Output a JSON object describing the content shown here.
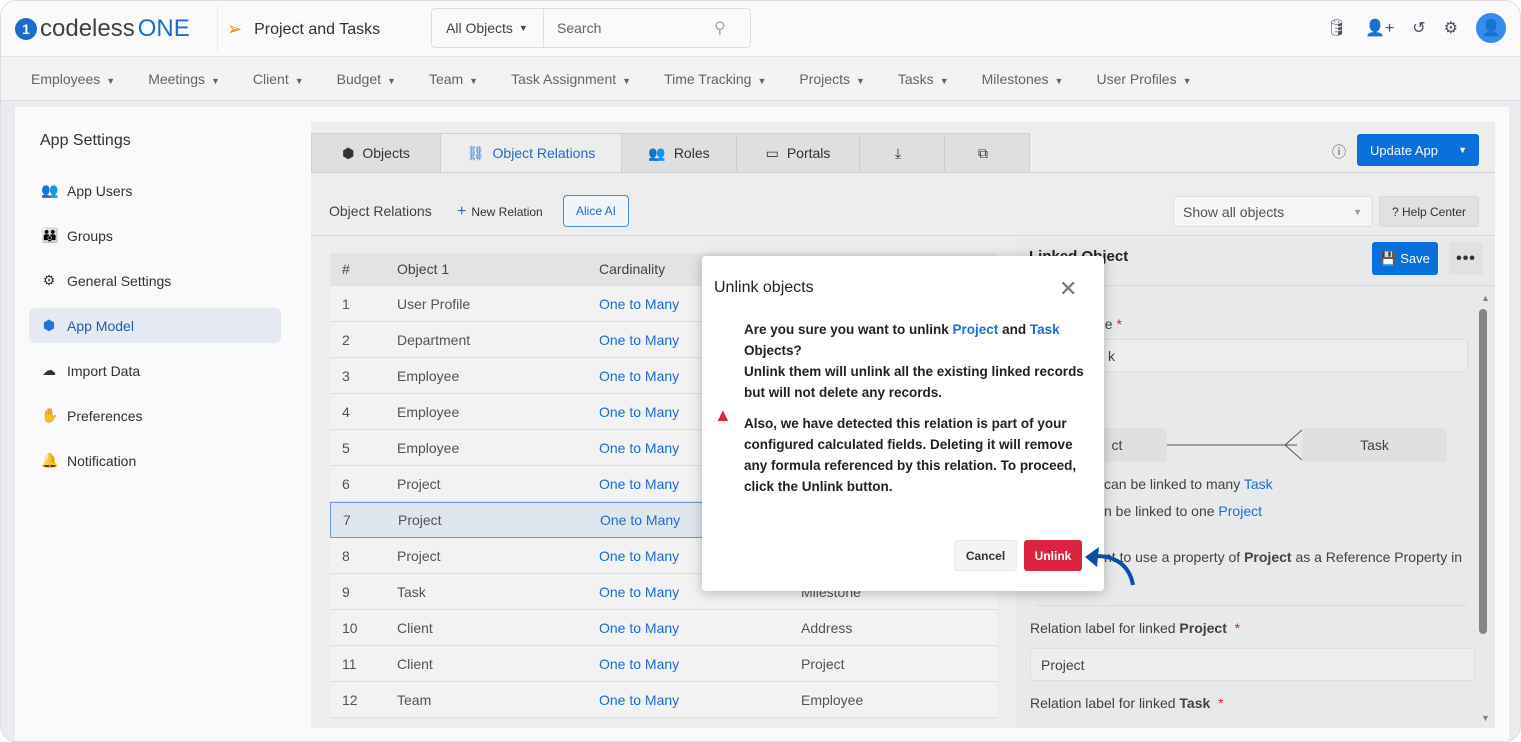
{
  "header": {
    "logo_mark": "1",
    "logo_text": "codeless",
    "logo_bold": "ONE",
    "app_title": "Project and Tasks",
    "search_scope": "All Objects",
    "search_placeholder": "Search"
  },
  "nav": [
    "Employees",
    "Meetings",
    "Client",
    "Budget",
    "Team",
    "Task Assignment",
    "Time Tracking",
    "Projects",
    "Tasks",
    "Milestones",
    "User Profiles"
  ],
  "sidebar": {
    "title": "App Settings",
    "items": [
      {
        "label": "App Users",
        "icon": "👥"
      },
      {
        "label": "Groups",
        "icon": "👪"
      },
      {
        "label": "General Settings",
        "icon": "⚙"
      },
      {
        "label": "App Model",
        "icon": "⬢"
      },
      {
        "label": "Import Data",
        "icon": "☁"
      },
      {
        "label": "Preferences",
        "icon": "✋"
      },
      {
        "label": "Notification",
        "icon": "🔔"
      }
    ]
  },
  "tabs": [
    {
      "label": "Objects",
      "icon": "⬢"
    },
    {
      "label": "Object Relations",
      "icon": "⛓"
    },
    {
      "label": "Roles",
      "icon": "👥"
    },
    {
      "label": "Portals",
      "icon": "▭"
    },
    {
      "label": "",
      "icon": "⤓"
    },
    {
      "label": "",
      "icon": "⧉"
    }
  ],
  "toolbar": {
    "update_app": "Update App",
    "section": "Object Relations",
    "new_relation": "New Relation",
    "alice": "Alice AI",
    "filter": "Show all objects",
    "help": "? Help Center"
  },
  "table": {
    "headers": [
      "#",
      "Object 1",
      "Cardinality",
      ""
    ],
    "rows": [
      [
        "1",
        "User Profile",
        "One to Many",
        ""
      ],
      [
        "2",
        "Department",
        "One to Many",
        ""
      ],
      [
        "3",
        "Employee",
        "One to Many",
        ""
      ],
      [
        "4",
        "Employee",
        "One to Many",
        ""
      ],
      [
        "5",
        "Employee",
        "One to Many",
        ""
      ],
      [
        "6",
        "Project",
        "One to Many",
        ""
      ],
      [
        "7",
        "Project",
        "One to Many",
        ""
      ],
      [
        "8",
        "Project",
        "One to Many",
        ""
      ],
      [
        "9",
        "Task",
        "One to Many",
        "Milestone"
      ],
      [
        "10",
        "Client",
        "One to Many",
        "Address"
      ],
      [
        "11",
        "Client",
        "One to Many",
        "Project"
      ],
      [
        "12",
        "Team",
        "One to Many",
        "Employee"
      ]
    ],
    "selected_row": 7
  },
  "linked": {
    "title": "Linked Object",
    "save": "Save",
    "name_label": "ne",
    "name_value": "k",
    "link_frag": "y",
    "left_box": "ct",
    "right_box": "Task",
    "line1": "can be linked to many ",
    "line1_obj": "Task",
    "line2": "n be linked to one ",
    "line2_obj": "Project",
    "ref_pre": "nt to use a property of ",
    "ref_obj": "Project",
    "ref_post": " as a Reference Property in",
    "label_project": "Relation label for linked ",
    "label_project_obj": "Project",
    "project_value": "Project",
    "label_task": "Relation label for linked ",
    "label_task_obj": "Task"
  },
  "modal": {
    "title": "Unlink objects",
    "q_pre": "Are you sure you want to unlink ",
    "obj1": "Project",
    "and": " and ",
    "obj2": "Task",
    "q_post": " Objects?",
    "line2": "Unlink them will unlink all the existing linked records but will not delete any records.",
    "warning": "Also, we have detected this relation is part of your configured calculated fields. Deleting it will remove any formula referenced by this relation. To proceed, click the Unlink button.",
    "cancel": "Cancel",
    "unlink": "Unlink"
  },
  "colors": {
    "primary": "#0a73e0",
    "danger": "#dc2340",
    "arrow": "#0b4fa8"
  }
}
